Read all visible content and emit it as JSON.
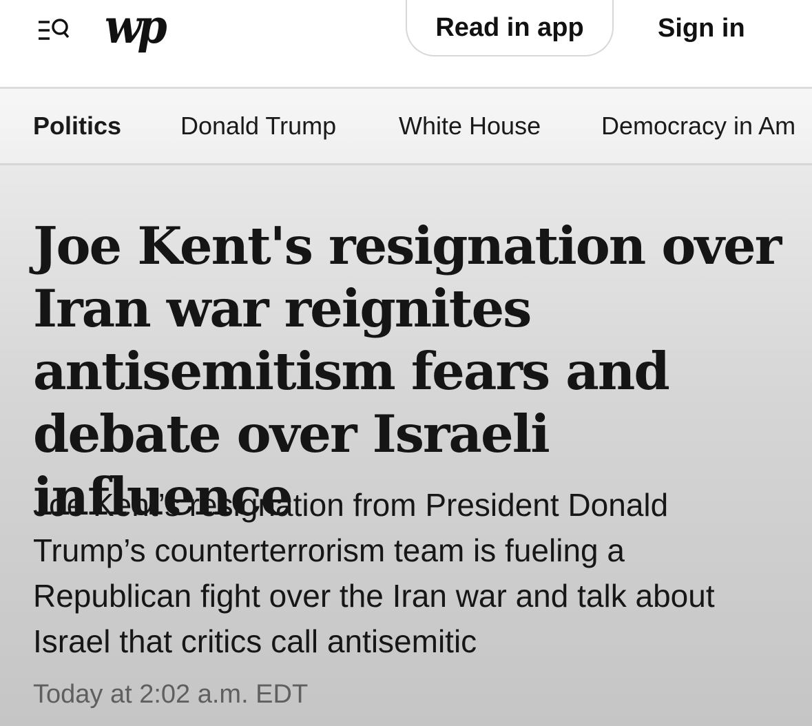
{
  "header": {
    "logo_text": "wp",
    "read_in_app_label": "Read in app",
    "sign_in_label": "Sign in"
  },
  "nav": {
    "items": [
      {
        "label": "Politics",
        "active": true
      },
      {
        "label": "Donald Trump",
        "active": false
      },
      {
        "label": "White House",
        "active": false
      },
      {
        "label": "Democracy in Am",
        "active": false
      }
    ]
  },
  "article": {
    "headline": "Joe Kent's resignation over Iran war reignites antisemitism fears and debate over Israeli influence",
    "dek": "Joe Kent’s resignation from President Donald Trump’s counterterrorism team is fueling a Republican fight over the Iran war and talk about Israel that critics call antisemitic",
    "timestamp": "Today at 2:02 a.m. EDT"
  },
  "icons": {
    "menu_search": "menu-search-icon"
  }
}
